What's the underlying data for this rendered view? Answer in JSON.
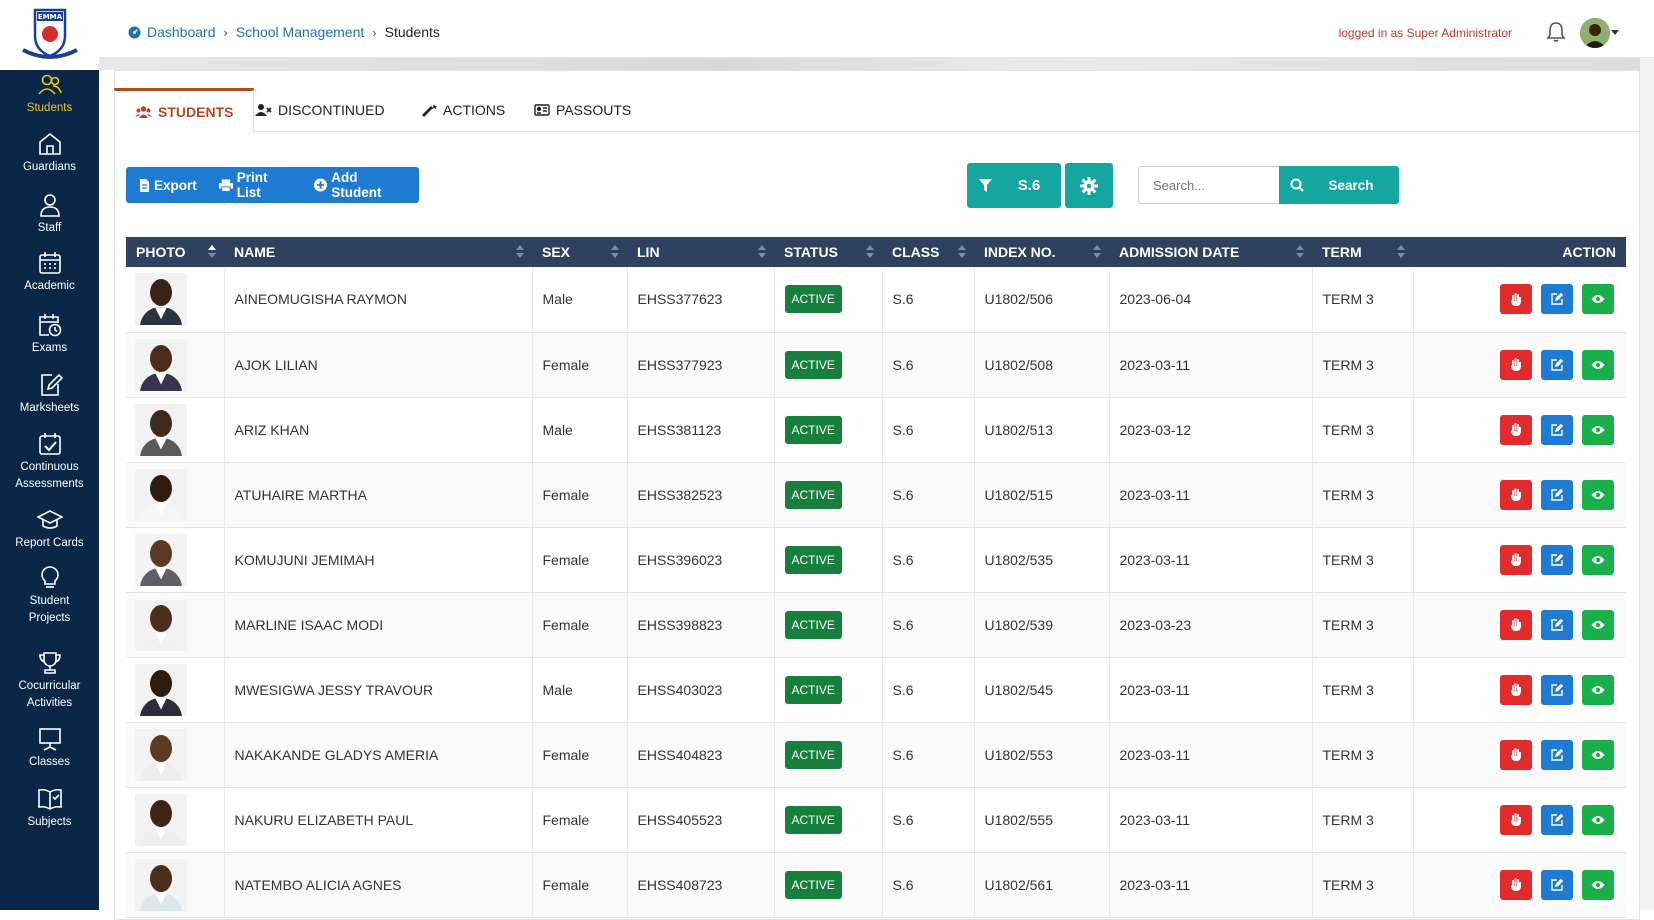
{
  "sidebar": {
    "logo_text": "EMMA",
    "items": [
      {
        "label": "Students",
        "icon": "users-icon",
        "active": true
      },
      {
        "label": "Guardians",
        "icon": "home-icon"
      },
      {
        "label": "Staff",
        "icon": "user-icon"
      },
      {
        "label": "Academic",
        "icon": "calendar-icon"
      },
      {
        "label": "Exams",
        "icon": "calendar-clock-icon"
      },
      {
        "label": "Marksheets",
        "icon": "edit-doc-icon"
      },
      {
        "label": "Continuous Assessments",
        "icon": "calendar-check-icon"
      },
      {
        "label": "Report Cards",
        "icon": "graduation-cap-icon"
      },
      {
        "label": "Student Projects",
        "icon": "lightbulb-icon"
      },
      {
        "label": "Cocurricular Activities",
        "icon": "trophy-icon"
      },
      {
        "label": "Classes",
        "icon": "presentation-icon"
      },
      {
        "label": "Subjects",
        "icon": "book-icon"
      }
    ]
  },
  "breadcrumb": {
    "home": "Dashboard",
    "section": "School Management",
    "current": "Students"
  },
  "header": {
    "login_text": "logged in as Super Administrator"
  },
  "tabs": [
    {
      "label": "STUDENTS",
      "icon": "users-icon",
      "active": true
    },
    {
      "label": "DISCONTINUED",
      "icon": "user-x-icon"
    },
    {
      "label": "ACTIONS",
      "icon": "wand-icon"
    },
    {
      "label": "PASSOUTS",
      "icon": "id-card-icon"
    }
  ],
  "toolbar": {
    "export_label": "Export",
    "print_label": "Print List",
    "add_label": "Add Student",
    "filter_value": "S.6"
  },
  "search": {
    "placeholder": "Search...",
    "button_label": "Search"
  },
  "table": {
    "columns": [
      "PHOTO",
      "NAME",
      "SEX",
      "LIN",
      "STATUS",
      "CLASS",
      "INDEX NO.",
      "ADMISSION DATE",
      "TERM",
      "ACTION"
    ],
    "rows": [
      {
        "name": "AINEOMUGISHA RAYMON",
        "sex": "Male",
        "lin": "EHSS377623",
        "status": "ACTIVE",
        "class": "S.6",
        "index": "U1802/506",
        "date": "2023-06-04",
        "term": "TERM 3"
      },
      {
        "name": "AJOK LILIAN",
        "sex": "Female",
        "lin": "EHSS377923",
        "status": "ACTIVE",
        "class": "S.6",
        "index": "U1802/508",
        "date": "2023-03-11",
        "term": "TERM 3"
      },
      {
        "name": "ARIZ KHAN",
        "sex": "Male",
        "lin": "EHSS381123",
        "status": "ACTIVE",
        "class": "S.6",
        "index": "U1802/513",
        "date": "2023-03-12",
        "term": "TERM 3"
      },
      {
        "name": "ATUHAIRE MARTHA",
        "sex": "Female",
        "lin": "EHSS382523",
        "status": "ACTIVE",
        "class": "S.6",
        "index": "U1802/515",
        "date": "2023-03-11",
        "term": "TERM 3"
      },
      {
        "name": "KOMUJUNI JEMIMAH",
        "sex": "Female",
        "lin": "EHSS396023",
        "status": "ACTIVE",
        "class": "S.6",
        "index": "U1802/535",
        "date": "2023-03-11",
        "term": "TERM 3"
      },
      {
        "name": "MARLINE ISAAC MODI",
        "sex": "Female",
        "lin": "EHSS398823",
        "status": "ACTIVE",
        "class": "S.6",
        "index": "U1802/539",
        "date": "2023-03-23",
        "term": "TERM 3"
      },
      {
        "name": "MWESIGWA JESSY TRAVOUR",
        "sex": "Male",
        "lin": "EHSS403023",
        "status": "ACTIVE",
        "class": "S.6",
        "index": "U1802/545",
        "date": "2023-03-11",
        "term": "TERM 3"
      },
      {
        "name": "NAKAKANDE GLADYS AMERIA",
        "sex": "Female",
        "lin": "EHSS404823",
        "status": "ACTIVE",
        "class": "S.6",
        "index": "U1802/553",
        "date": "2023-03-11",
        "term": "TERM 3"
      },
      {
        "name": "NAKURU ELIZABETH PAUL",
        "sex": "Female",
        "lin": "EHSS405523",
        "status": "ACTIVE",
        "class": "S.6",
        "index": "U1802/555",
        "date": "2023-03-11",
        "term": "TERM 3"
      },
      {
        "name": "NATEMBO ALICIA AGNES",
        "sex": "Female",
        "lin": "EHSS408723",
        "status": "ACTIVE",
        "class": "S.6",
        "index": "U1802/561",
        "date": "2023-03-11",
        "term": "TERM 3"
      }
    ]
  },
  "colors": {
    "sidebar_bg": "#0a2747",
    "accent": "#15a6a0",
    "primary": "#1f7bd1",
    "active_tab": "#b5471f",
    "status_active": "#16803c"
  }
}
